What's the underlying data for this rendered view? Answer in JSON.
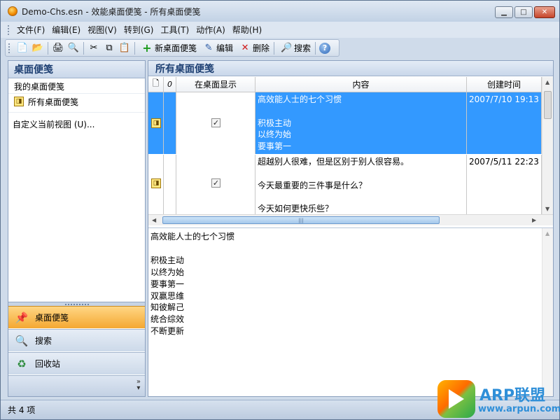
{
  "window": {
    "title": "Demo-Chs.esn - 效能桌面便笺 - 所有桌面便笺",
    "minimize": "▁",
    "maximize": "□",
    "close": "✕"
  },
  "menu": [
    {
      "label": "文件(F)"
    },
    {
      "label": "编辑(E)"
    },
    {
      "label": "视图(V)"
    },
    {
      "label": "转到(G)"
    },
    {
      "label": "工具(T)"
    },
    {
      "label": "动作(A)"
    },
    {
      "label": "帮助(H)"
    }
  ],
  "toolbar": {
    "new_label": "新桌面便笺",
    "edit_label": "编辑",
    "delete_label": "删除",
    "search_label": "搜索",
    "icons": {
      "new_doc": "📄",
      "open": "📂",
      "print": "🖨",
      "preview": "🔍",
      "cut": "✂",
      "copy": "⧉",
      "paste": "📋",
      "add": "+",
      "edit": "✎",
      "delete": "✕",
      "search": "🔎",
      "help": "?"
    }
  },
  "left_pane": {
    "header": "桌面便笺",
    "section": "我的桌面便笺",
    "folder": "所有桌面便笺",
    "customize_link": "自定义当前视图 (U)...",
    "nav": [
      {
        "label": "桌面便笺",
        "icon": "📌"
      },
      {
        "label": "搜索",
        "icon": "🔍"
      },
      {
        "label": "回收站",
        "icon": "♻"
      }
    ],
    "more_icon": "»\n▾"
  },
  "right_pane": {
    "header": "所有桌面便笺",
    "columns": {
      "icon": "🗋",
      "attach": "0",
      "show_desktop": "在桌面显示",
      "content": "内容",
      "created": "创建时间"
    },
    "rows": [
      {
        "content": "高效能人士的七个习惯\n\n积极主动\n以终为始\n要事第一",
        "created": "2007/7/10 19:13",
        "checked": "✓"
      },
      {
        "content": "超越别人很难，但是区别于别人很容易。\n\n今天最重要的三件事是什么？\n\n今天如何更快乐些？",
        "created": "2007/5/11 22:23",
        "checked": "✓"
      }
    ],
    "hscroll_grip": "|||",
    "preview_text": "高效能人士的七个习惯\n\n积极主动\n以终为始\n要事第一\n双赢思维\n知彼解己\n统合综效\n不断更新"
  },
  "status": {
    "count": "共 4 项"
  },
  "watermark": {
    "title": "ARP联盟",
    "url": "www.arpun.com"
  }
}
